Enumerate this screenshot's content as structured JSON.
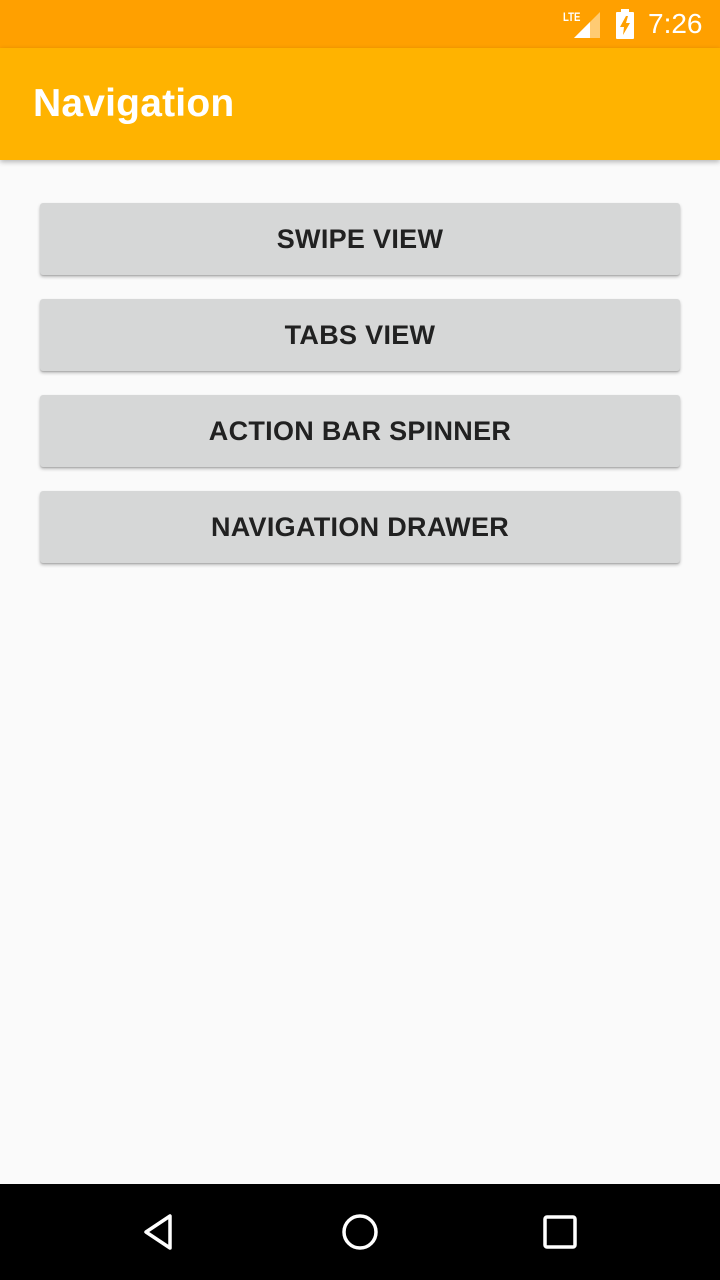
{
  "status_bar": {
    "network": "LTE",
    "time": "7:26",
    "background_color": "#ffa000",
    "icons": [
      "signal-icon",
      "battery-charging-icon"
    ]
  },
  "app_bar": {
    "title": "Navigation",
    "background_color": "#ffb300"
  },
  "buttons": [
    {
      "label": "SWIPE VIEW"
    },
    {
      "label": "TABS VIEW"
    },
    {
      "label": "ACTION BAR SPINNER"
    },
    {
      "label": "NAVIGATION DRAWER"
    }
  ],
  "nav_bar": {
    "icons": [
      "back-icon",
      "home-icon",
      "recents-icon"
    ]
  }
}
